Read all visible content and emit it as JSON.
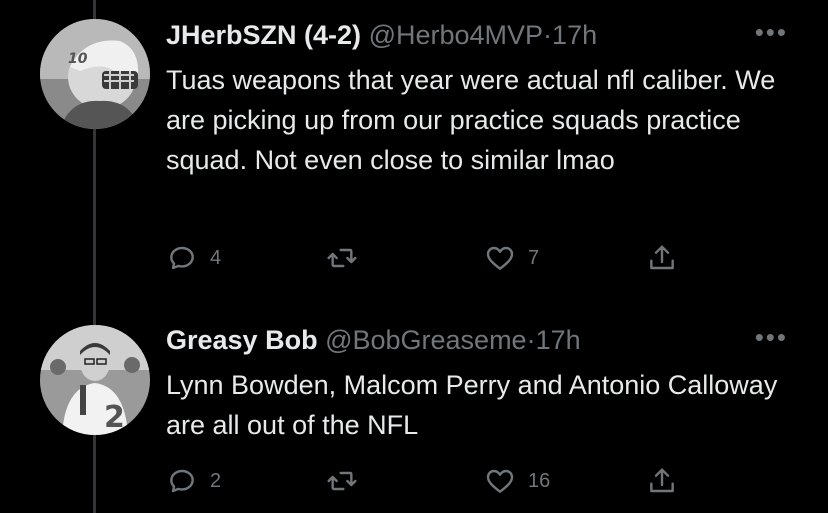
{
  "tweets": [
    {
      "name": "JHerbSZN (4-2)",
      "handle": "@Herbo4MVP",
      "separator": "·",
      "time": "17h",
      "more": "•••",
      "text": "Tuas weapons that year were actual nfl caliber. We are picking up from our practice squads practice squad.  Not even close to similar lmao",
      "replies": "4",
      "retweets": "",
      "likes": "7"
    },
    {
      "name": "Greasy Bob",
      "handle": "@BobGreaseme",
      "separator": "·",
      "time": "17h",
      "more": "•••",
      "text": "Lynn Bowden, Malcom Perry and Antonio Calloway are all out of the NFL",
      "replies": "2",
      "retweets": "",
      "likes": "16"
    }
  ],
  "icons": {
    "reply": "reply-icon",
    "retweet": "retweet-icon",
    "like": "heart-icon",
    "share": "share-icon",
    "more": "more-icon"
  },
  "colors": {
    "background": "#000000",
    "text": "#e7e9ea",
    "secondary": "#71767b",
    "thread_line": "#333639"
  }
}
